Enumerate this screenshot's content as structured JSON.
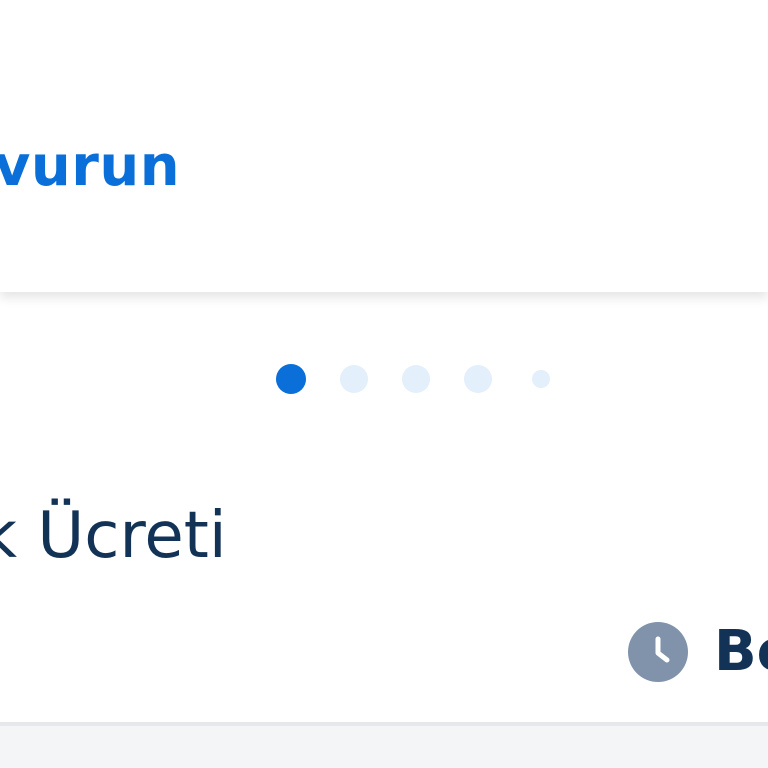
{
  "top_card": {
    "cta_text": "svurun"
  },
  "carousel": {
    "indicators": [
      {
        "state": "active"
      },
      {
        "state": "inactive"
      },
      {
        "state": "inactive"
      },
      {
        "state": "inactive"
      },
      {
        "state": "inactive-small"
      }
    ]
  },
  "item": {
    "title": "k Ücreti",
    "status_icon": "clock-icon",
    "status_text": "Be"
  },
  "colors": {
    "accent": "#0a6fd8",
    "title_text": "#123256",
    "indicator_inactive": "#e3effb",
    "status_icon_bg": "#8193ab"
  }
}
